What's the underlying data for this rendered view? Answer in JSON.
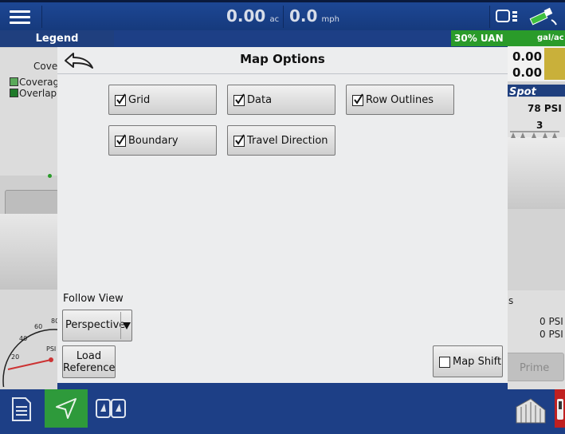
{
  "topbar": {
    "area_value": "0.00",
    "area_unit": "ac",
    "speed_value": "0.0",
    "speed_unit": "mph"
  },
  "left_panel": {
    "legend_title": "Legend",
    "coverage_heading": "Cove",
    "coverage_label": "Coverag",
    "overlap_label": "Overlap"
  },
  "right_panel": {
    "product": "30% UAN",
    "rate_unit": "gal/ac",
    "value_1": "0.00",
    "value_2": "0.00",
    "brand": "Spot",
    "pressure": "78 PSI",
    "section_count": "3",
    "psi_1": "0 PSI",
    "psi_2": "0 PSI",
    "prime_label": "Prime",
    "partial_s": "s"
  },
  "gauge": {
    "unit": "PSI",
    "ticks": [
      "20",
      "40",
      "60",
      "80"
    ]
  },
  "dialog": {
    "title": "Map Options",
    "options": [
      {
        "label": "Grid",
        "checked": true
      },
      {
        "label": "Data",
        "checked": true
      },
      {
        "label": "Row Outlines",
        "checked": true
      },
      {
        "label": "Boundary",
        "checked": true
      },
      {
        "label": "Travel Direction",
        "checked": true
      }
    ],
    "follow_view_label": "Follow View",
    "follow_view_value": "Perspective",
    "load_reference_line1": "Load",
    "load_reference_line2": "Reference",
    "map_shift_label": "Map Shift",
    "map_shift_checked": false
  },
  "colors": {
    "topbar": "#1d4794",
    "dialog_bg": "#ecedee",
    "nav_active": "#2e9a3b",
    "uan_green": "#2a9b2a"
  }
}
